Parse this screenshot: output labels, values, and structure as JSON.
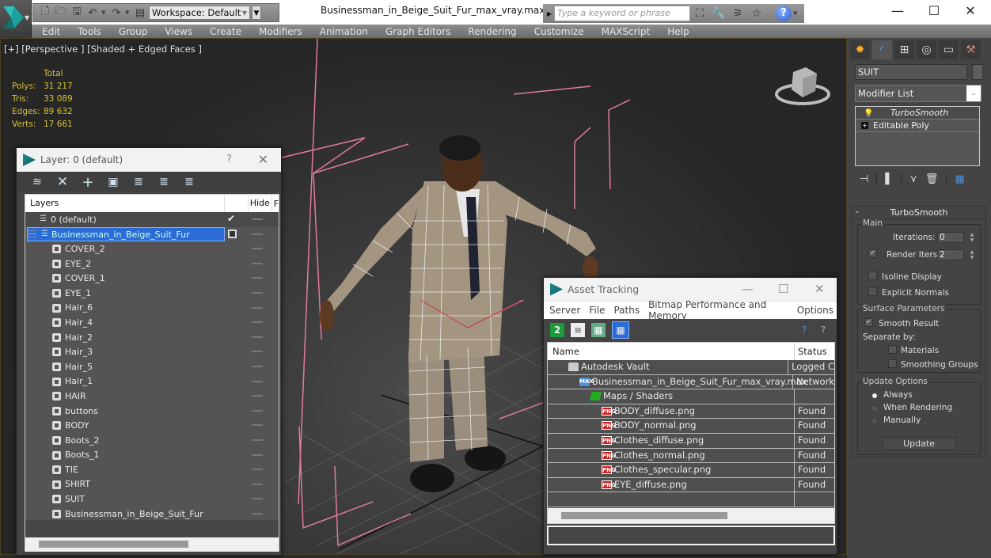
{
  "app": {
    "document_title": "Businessman_in_Beige_Suit_Fur_max_vray.max",
    "workspace": "Workspace: Default",
    "search_placeholder": "Type a keyword or phrase",
    "window_controls": {
      "minimize": "—",
      "maximize": "☐",
      "close": "✕"
    }
  },
  "menu": [
    "Edit",
    "Tools",
    "Group",
    "Views",
    "Create",
    "Modifiers",
    "Animation",
    "Graph Editors",
    "Rendering",
    "Customize",
    "MAXScript",
    "Help"
  ],
  "viewport": {
    "label": "[+] [Perspective ] [Shaded + Edged Faces ]",
    "stats": {
      "header": "Total",
      "rows": [
        {
          "label": "Polys:",
          "value": "31 217"
        },
        {
          "label": "Tris:",
          "value": "33 089"
        },
        {
          "label": "Edges:",
          "value": "89 632"
        },
        {
          "label": "Verts:",
          "value": "17 661"
        }
      ]
    },
    "colors": {
      "wire": "#ffffff",
      "helper": "#e07aa0",
      "stats": "#d4c13a"
    }
  },
  "layer_dialog": {
    "title": "Layer: 0 (default)",
    "help": "?",
    "close": "✕",
    "columns": {
      "layers": "Layers",
      "hide": "Hide",
      "freeze": "F"
    },
    "rows": [
      {
        "name": "0 (default)",
        "type": "layer",
        "current": true
      },
      {
        "name": "Businessman_in_Beige_Suit_Fur",
        "type": "layer",
        "selected": true
      },
      {
        "name": "COVER_2",
        "type": "object"
      },
      {
        "name": "EYE_2",
        "type": "object"
      },
      {
        "name": "COVER_1",
        "type": "object"
      },
      {
        "name": "EYE_1",
        "type": "object"
      },
      {
        "name": "Hair_6",
        "type": "object"
      },
      {
        "name": "Hair_4",
        "type": "object"
      },
      {
        "name": "Hair_2",
        "type": "object"
      },
      {
        "name": "Hair_3",
        "type": "object"
      },
      {
        "name": "Hair_5",
        "type": "object"
      },
      {
        "name": "Hair_1",
        "type": "object"
      },
      {
        "name": "HAIR",
        "type": "object"
      },
      {
        "name": "buttons",
        "type": "object"
      },
      {
        "name": "BODY",
        "type": "object"
      },
      {
        "name": "Boots_2",
        "type": "object"
      },
      {
        "name": "Boots_1",
        "type": "object"
      },
      {
        "name": "TIE",
        "type": "object"
      },
      {
        "name": "SHIRT",
        "type": "object"
      },
      {
        "name": "SUIT",
        "type": "object"
      },
      {
        "name": "Businessman_in_Beige_Suit_Fur",
        "type": "object"
      }
    ]
  },
  "asset_tracking": {
    "title": "Asset Tracking",
    "menu": [
      "Server",
      "File",
      "Paths",
      "Bitmap Performance and Memory",
      "Options"
    ],
    "columns": {
      "name": "Name",
      "status": "Status"
    },
    "rows": [
      {
        "name": "Autodesk Vault",
        "status": "Logged C",
        "icon": "vault",
        "indent": 1
      },
      {
        "name": "Businessman_in_Beige_Suit_Fur_max_vray.max",
        "status": "Network",
        "icon": "max",
        "indent": 2
      },
      {
        "name": "Maps / Shaders",
        "status": "",
        "icon": "maps",
        "indent": 3
      },
      {
        "name": "BODY_diffuse.png",
        "status": "Found",
        "icon": "png",
        "indent": 4
      },
      {
        "name": "BODY_normal.png",
        "status": "Found",
        "icon": "png",
        "indent": 4
      },
      {
        "name": "Clothes_diffuse.png",
        "status": "Found",
        "icon": "png",
        "indent": 4
      },
      {
        "name": "Clothes_normal.png",
        "status": "Found",
        "icon": "png",
        "indent": 4
      },
      {
        "name": "Clothes_specular.png",
        "status": "Found",
        "icon": "png",
        "indent": 4
      },
      {
        "name": "EYE_diffuse.png",
        "status": "Found",
        "icon": "png",
        "indent": 4
      }
    ],
    "icon_labels": {
      "png": "PNG",
      "max": "MAX"
    }
  },
  "command_panel": {
    "object_name": "SUIT",
    "modifier_list": "Modifier List",
    "stack": [
      {
        "name": "TurboSmooth",
        "selected": true
      },
      {
        "name": "Editable Poly"
      }
    ],
    "turbosmooth": {
      "title": "TurboSmooth",
      "collapse": "-",
      "main": {
        "label": "Main",
        "iterations_label": "Iterations:",
        "iterations": "0",
        "render_iters_label": "Render Iters:",
        "render_iters": "2",
        "render_iters_checked": true,
        "isoline_display": "Isoline Display",
        "explicit_normals": "Explicit Normals"
      },
      "surface": {
        "label": "Surface Parameters",
        "smooth_result": "Smooth Result",
        "separate_by": "Separate by:",
        "materials": "Materials",
        "smoothing_groups": "Smoothing Groups"
      },
      "update": {
        "label": "Update Options",
        "always": "Always",
        "when_rendering": "When Rendering",
        "manually": "Manually",
        "button": "Update",
        "selected": "Always"
      }
    }
  }
}
